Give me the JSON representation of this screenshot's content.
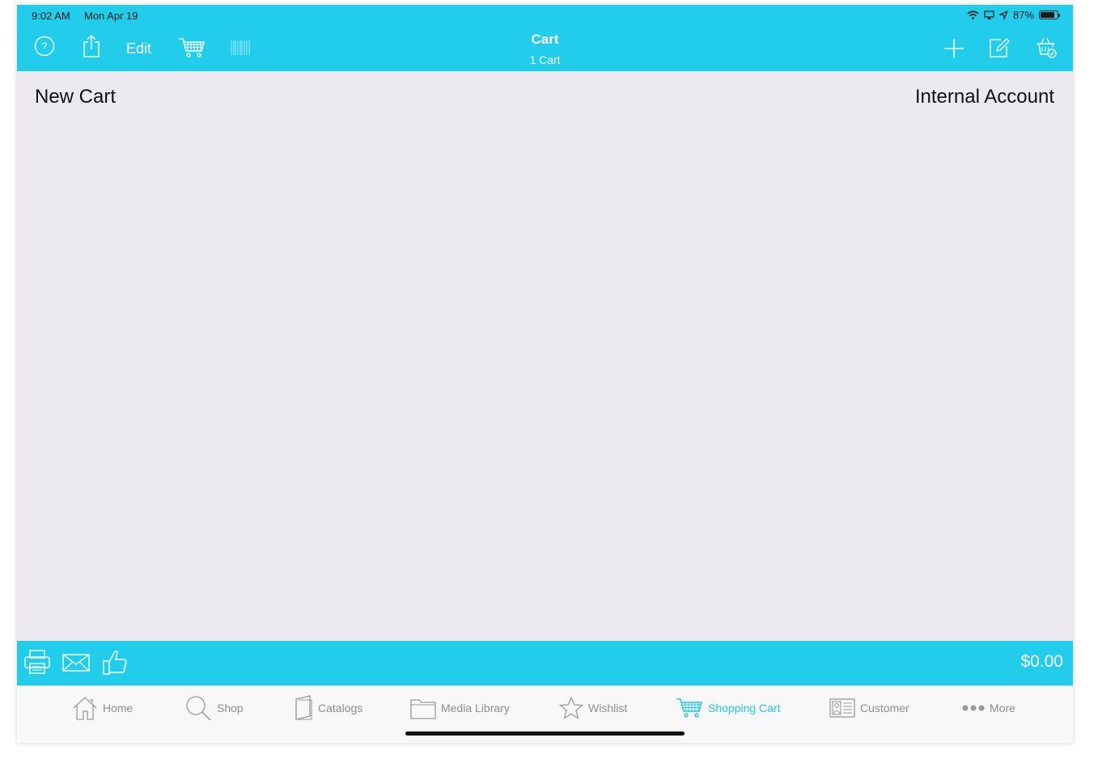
{
  "status_bar": {
    "time": "9:02 AM",
    "date": "Mon Apr 19",
    "battery_text": "87%",
    "battery_level": 0.87
  },
  "nav_bar": {
    "title": "Cart",
    "subtitle": "1 Cart",
    "edit_label": "Edit",
    "left_icons": [
      "help-icon",
      "share-icon",
      "cart-icon",
      "barcode-icon"
    ],
    "right_icons": [
      "plus-icon",
      "compose-icon",
      "basket-check-icon"
    ]
  },
  "content": {
    "cart_name": "New Cart",
    "account": "Internal Account"
  },
  "footer": {
    "total": "$0.00",
    "icons": [
      "printer-icon",
      "mail-icon",
      "thumbs-up-icon"
    ]
  },
  "tabs": [
    {
      "label": "Home",
      "icon": "home-icon"
    },
    {
      "label": "Shop",
      "icon": "search-icon"
    },
    {
      "label": "Catalogs",
      "icon": "book-icon"
    },
    {
      "label": "Media Library",
      "icon": "folder-icon"
    },
    {
      "label": "Wishlist",
      "icon": "star-icon"
    },
    {
      "label": "Shopping Cart",
      "icon": "cart-icon",
      "active": true
    },
    {
      "label": "Customer",
      "icon": "contact-card-icon"
    },
    {
      "label": "More",
      "icon": "more-icon"
    }
  ],
  "colors": {
    "accent": "#22cdeb",
    "active_tab": "#22c8e6",
    "background": "#edeaef"
  }
}
